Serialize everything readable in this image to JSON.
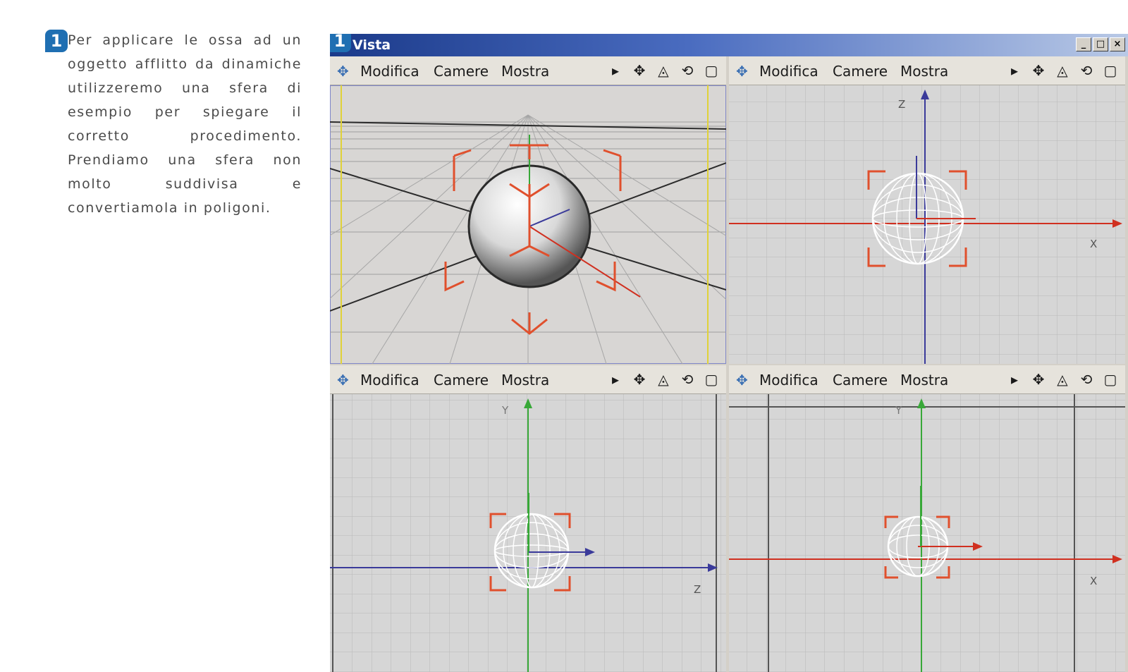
{
  "article": {
    "step_number": "1",
    "text": "Per applicare le ossa ad un oggetto afflitto da dinamiche utilizzeremo una sfera di esempio per spiegare il corretto procedimento. Prendiamo una sfera non molto suddivisa e convertiamola in poligoni."
  },
  "window": {
    "step_number": "1",
    "title": "Vista",
    "controls": {
      "minimize": "_",
      "maximize": "□",
      "close": "×"
    }
  },
  "viewports": [
    {
      "id": "perspective",
      "menu": [
        "Modifica",
        "Camere",
        "Mostra"
      ],
      "axes": []
    },
    {
      "id": "front",
      "menu": [
        "Modifica",
        "Camere",
        "Mostra"
      ],
      "axes": [
        "Z",
        "X"
      ]
    },
    {
      "id": "side",
      "menu": [
        "Modifica",
        "Camere",
        "Mostra"
      ],
      "axes": [
        "Y",
        "Z"
      ]
    },
    {
      "id": "top",
      "menu": [
        "Modifica",
        "Camere",
        "Mostra"
      ],
      "axes": [
        "Y",
        "X"
      ]
    }
  ],
  "toolbar_icons": [
    "play-arrow-icon",
    "move-icon",
    "scale-icon",
    "rotate-icon",
    "maximize-view-icon"
  ],
  "colors": {
    "title_bar": "#1b3a8a",
    "step_badge": "#1f6fb2",
    "x_axis": "#d03020",
    "y_axis": "#38a838",
    "z_axis": "#3a3a9a",
    "grid": "#b8b8b8",
    "viewport_bg": "#d6d6d6"
  }
}
